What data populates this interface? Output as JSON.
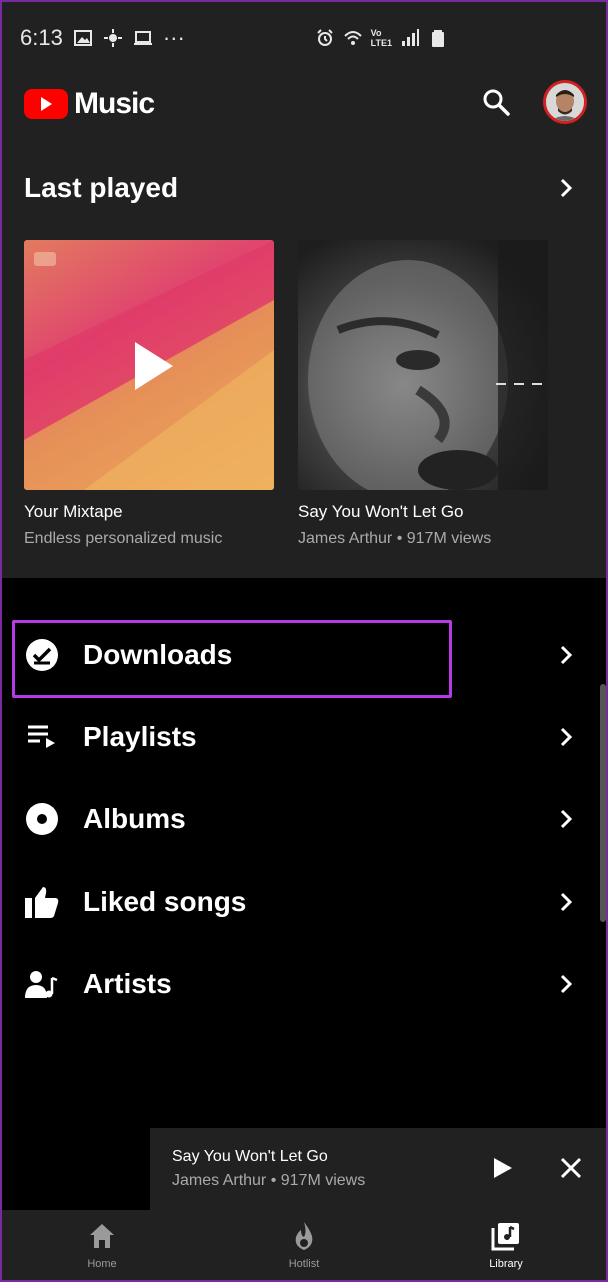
{
  "status_bar": {
    "time": "6:13",
    "more": "···",
    "network_top": "Vo",
    "network_bottom": "LTE1"
  },
  "app": {
    "name": "Music",
    "brand_color": "#ff0000"
  },
  "last_played": {
    "title": "Last played",
    "cards": [
      {
        "title": "Your Mixtape",
        "subtitle": "Endless personalized music"
      },
      {
        "title": "Say You Won't Let Go",
        "subtitle": "James Arthur • 917M views"
      }
    ]
  },
  "library": {
    "items": [
      {
        "label": "Downloads",
        "icon": "download-done-icon",
        "highlighted": true
      },
      {
        "label": "Playlists",
        "icon": "playlist-icon"
      },
      {
        "label": "Albums",
        "icon": "album-icon"
      },
      {
        "label": "Liked songs",
        "icon": "thumb-up-icon"
      },
      {
        "label": "Artists",
        "icon": "artist-icon"
      }
    ],
    "highlight_color": "#b43be6"
  },
  "mini_player": {
    "title": "Say You Won't Let Go",
    "subtitle": "James Arthur • 917M views"
  },
  "bottom_nav": {
    "items": [
      {
        "label": "Home",
        "icon": "home-icon"
      },
      {
        "label": "Hotlist",
        "icon": "flame-icon"
      },
      {
        "label": "Library",
        "icon": "library-icon",
        "active": true
      }
    ]
  }
}
